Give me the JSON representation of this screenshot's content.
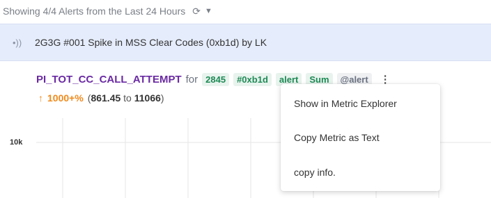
{
  "header": {
    "summary": "Showing 4/4 Alerts from the Last 24 Hours",
    "refresh_icon": "refresh-icon",
    "caret_icon": "chevron-down-icon"
  },
  "alert": {
    "signal_icon": "signal-icon",
    "title": "2G3G #001 Spike in MSS Clear Codes (0xb1d) by LK"
  },
  "metric": {
    "name": "PI_TOT_CC_CALL_ATTEMPT",
    "for_label": "for",
    "tags": [
      "2845",
      "#0xb1d",
      "alert",
      "Sum"
    ],
    "mention_tag": "@alert",
    "more_icon": "kebab-icon",
    "change_arrow": "↑",
    "change_pct": "1000+%",
    "range_open": "(",
    "range_from": "861.45",
    "range_to_word": "to",
    "range_to": "11066",
    "range_close": ")"
  },
  "chart": {
    "y_tick_label": "10k"
  },
  "menu": {
    "items": [
      "Show in Metric Explorer",
      "Copy Metric as Text",
      "copy info."
    ]
  },
  "colors": {
    "metric_name": "#6a2aa3",
    "tag_text": "#1e8a55",
    "change": "#f08a1c",
    "alert_bg": "#e5ecfb"
  }
}
